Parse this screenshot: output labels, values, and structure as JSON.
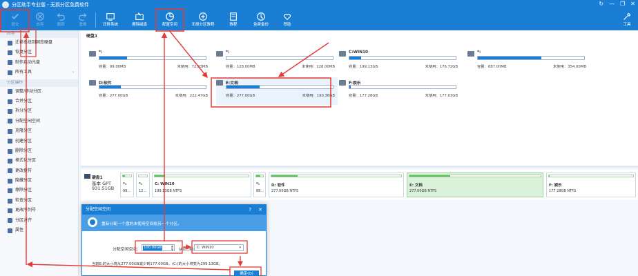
{
  "window": {
    "title": "分区助手专业版 - 无损分区免费软件",
    "controls": [
      "↻",
      "—",
      "❐",
      "✕"
    ]
  },
  "toolbar": {
    "items": [
      {
        "label": "提交",
        "icon": "check-icon",
        "dim": true
      },
      {
        "label": "放弃",
        "icon": "discard-icon",
        "dim": true
      },
      {
        "label": "撤销",
        "icon": "undo-icon",
        "dim": true
      },
      {
        "label": "重做",
        "icon": "redo-icon",
        "dim": true
      },
      {
        "label": "迁移系统",
        "icon": "migrate-os-icon",
        "dim": false
      },
      {
        "label": "擦除磁盘",
        "icon": "wipe-disk-icon",
        "dim": false
      },
      {
        "label": "配置空间",
        "icon": "allocate-space-icon",
        "dim": false
      },
      {
        "label": "无损分区教程",
        "icon": "tutorial-icon",
        "dim": false
      },
      {
        "label": "教程",
        "icon": "document-icon",
        "dim": false
      },
      {
        "label": "免费备份",
        "icon": "backup-icon",
        "dim": false
      },
      {
        "label": "赞助",
        "icon": "heart-icon",
        "dim": false
      },
      {
        "label": "工具",
        "icon": "tools-icon",
        "dim": false
      }
    ]
  },
  "sidebar": {
    "sections": [
      {
        "title": "向导",
        "items": [
          {
            "label": "迁移系统到固态硬盘",
            "arrow": ""
          },
          {
            "label": "恢复分区",
            "arrow": ""
          },
          {
            "label": "制作启动光盘",
            "arrow": ""
          },
          {
            "label": "所有工具",
            "arrow": "›"
          }
        ]
      },
      {
        "title": "分区操作",
        "items": [
          {
            "label": "调整/移动分区",
            "arrow": ""
          },
          {
            "label": "合并分区",
            "arrow": ""
          },
          {
            "label": "拆分分区",
            "arrow": ""
          },
          {
            "label": "分配空闲空间",
            "arrow": ""
          },
          {
            "label": "克隆分区",
            "arrow": ""
          },
          {
            "label": "创建分区",
            "arrow": ""
          },
          {
            "label": "删除分区",
            "arrow": ""
          },
          {
            "label": "格式化分区",
            "arrow": ""
          },
          {
            "label": "更改盘符",
            "arrow": ""
          },
          {
            "label": "隐藏分区",
            "arrow": ""
          },
          {
            "label": "擦除分区",
            "arrow": ""
          },
          {
            "label": "检查分区",
            "arrow": ""
          },
          {
            "label": "更改序列号",
            "arrow": ""
          },
          {
            "label": "分区对齐",
            "arrow": ""
          },
          {
            "label": "属性",
            "arrow": ""
          }
        ]
      }
    ]
  },
  "disk_panel": {
    "disk_name": "硬盘1",
    "cards": [
      {
        "name": "*:",
        "capacity": "容量：99.00MB",
        "free": "未使用：72.83MB",
        "used_fraction": 0.26,
        "selected": false
      },
      {
        "name": "*:",
        "capacity": "容量：128.00MB",
        "free": "未使用：128.00MB",
        "used_fraction": 0.0,
        "selected": false
      },
      {
        "name": "C:WIN10",
        "capacity": "容量：199.13GB",
        "free": "未使用：176.72GB",
        "used_fraction": 0.11,
        "selected": false
      },
      {
        "name": "*:",
        "capacity": "容量：887.00MB",
        "free": "未使用：354.00MB",
        "used_fraction": 0.6,
        "selected": false
      },
      {
        "name": "D:软件",
        "capacity": "容量：277.00GB",
        "free": "未使用：222.47GB",
        "used_fraction": 0.2,
        "selected": false
      },
      {
        "name": "E:文档",
        "capacity": "容量：277.00GB",
        "free": "未使用：190.36GB",
        "used_fraction": 0.31,
        "selected": true
      },
      {
        "name": "F:娱乐",
        "capacity": "容量：177.28GB",
        "free": "未使用：177.03GB",
        "used_fraction": 0.01,
        "selected": false
      }
    ]
  },
  "partition_strip": {
    "disk_name": "硬盘1",
    "disk_type": "基本 GPT",
    "disk_size": "931.51GB",
    "blocks": [
      {
        "name": "*:",
        "size": "99...",
        "fill": 0.26,
        "selected": false
      },
      {
        "name": "*:",
        "size": "12...",
        "fill": 0.0,
        "selected": false
      },
      {
        "name": "C: WIN10",
        "size": "199.13GB NTFS",
        "fill": 0.11,
        "selected": false
      },
      {
        "name": "*:",
        "size": "88...",
        "fill": 0.6,
        "selected": false
      },
      {
        "name": "D: 软件",
        "size": "277.00GB NTFS",
        "fill": 0.2,
        "selected": false
      },
      {
        "name": "E: 文档",
        "size": "277.00GB NTFS",
        "fill": 0.31,
        "selected": true
      },
      {
        "name": "F: 娱乐",
        "size": "177.28GB NTFS",
        "fill": 0.01,
        "selected": false
      }
    ]
  },
  "dialog": {
    "title": "分配空闲空间",
    "help": "?",
    "close": "✕",
    "banner": "重新分配一个盘的未使用空间给另一个分区。",
    "size_label": "分配空闲空间：",
    "size_value": "100.00GB",
    "target_label": "从(E:)给：",
    "target_value": "C: WIN10",
    "hint": "当前E:的大小将从277.00GB减少到177.00GB，(C:)的大小将变为299.13GB。",
    "ok_label": "确定(O)"
  },
  "annotation_color": "#e53935"
}
